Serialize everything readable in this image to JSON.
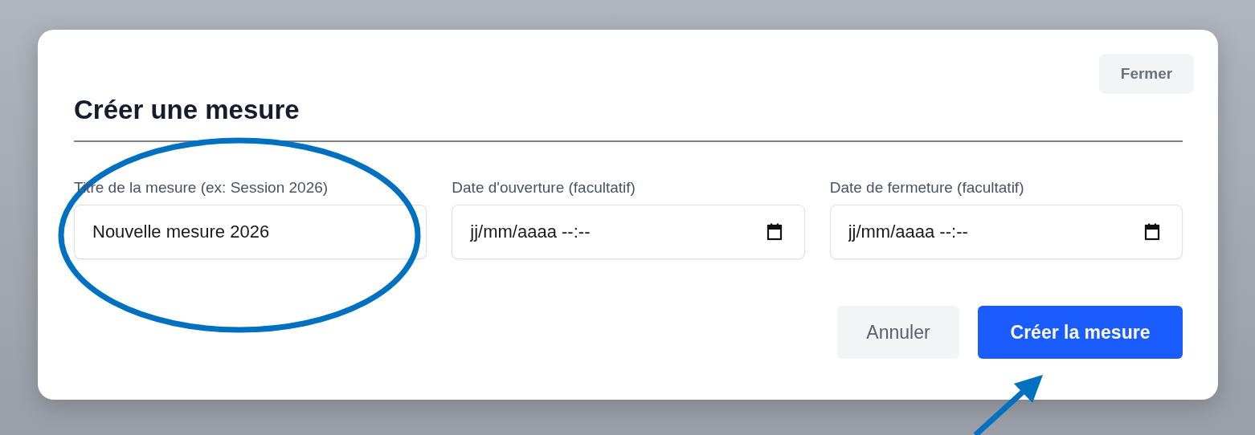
{
  "dialog": {
    "title": "Créer une mesure",
    "close_button": "Fermer",
    "fields": [
      {
        "kind": "text",
        "label": "Titre de la mesure (ex: Session 2026)",
        "value": "Nouvelle mesure 2026"
      },
      {
        "kind": "datetime",
        "label": "Date d'ouverture (facultatif)",
        "placeholder": "jj/mm/aaaa --:--"
      },
      {
        "kind": "datetime",
        "label": "Date de fermeture (facultatif)",
        "placeholder": "jj/mm/aaaa --:--"
      }
    ],
    "buttons": [
      {
        "kind": "secondary",
        "label": "Annuler"
      },
      {
        "kind": "primary",
        "label": "Créer la mesure"
      }
    ]
  }
}
